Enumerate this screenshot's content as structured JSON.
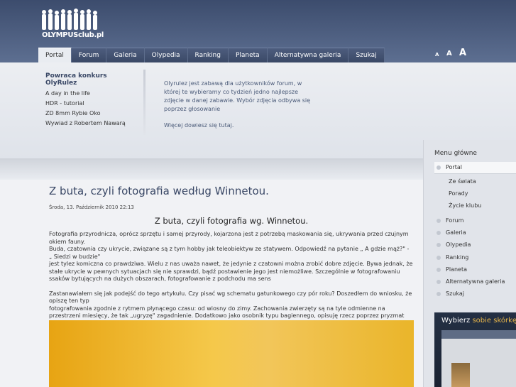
{
  "header": {
    "logo_text": "OLYMPUSclub.pl"
  },
  "nav": {
    "tabs": [
      "Portal",
      "Forum",
      "Galeria",
      "Olypedia",
      "Ranking",
      "Planeta",
      "Alternatywna galeria",
      "Szukaj"
    ],
    "active": "Portal"
  },
  "font_size_controls": [
    "A",
    "A",
    "A"
  ],
  "feature": {
    "title": "Powraca konkurs OlyRulez",
    "items": [
      "A day in the life",
      "HDR - tutorial",
      "ZD 8mm Rybie Oko",
      "Wywiad z Robertem Nawarą"
    ]
  },
  "description": {
    "text": "Olyrulez jest zabawą dla użytkowników forum, w której te wybieramy co tydzień jedno najlepsze zdjęcie w danej zabawie. Wybór zdjęcia odbywa się poprzez głosowanie",
    "more": "Więcej dowiesz się tutaj."
  },
  "article": {
    "title": "Z buta, czyli fotografia według Winnetou.",
    "date": "Środa, 13. Październik 2010 22:13",
    "subtitle": "Z buta, czyli fotografia wg. Winnetou.",
    "paragraphs": [
      "Fotografia przyrodnicza, oprócz sprzętu i samej przyrody, kojarzona jest z potrzebą maskowania się, ukrywania przed czujnym okiem fauny.",
      "Buda, czatownia czy ukrycie, związane są z tym hobby jak teleobiektyw ze statywem. Odpowiedź na pytanie „ A gdzie mąż?\" - „ Siedzi w budzie\"",
      "jest tylez komiczna co prawdziwa. Wielu z nas uważa nawet, że jedynie z czatowni można zrobić dobre zdjęcie. Bywa jednak, że stałe ukrycie w pewnych sytuacjach się nie sprawdzi, bądź postawienie jego jest niemożliwe. Szczególnie w fotografowaniu ssaków bytujących na dużych obszarach, fotografowanie z podchodu ma sens",
      "Zastanawiałem się jak podejść do tego artykułu. Czy pisać wg schematu gatunkowego czy pór roku? Doszedłem do wniosku, że opiszę ten typ",
      "fotografowania zgodnie z rytmem płynącego czasu: od wiosny do zimy. Zachowania zwierzęty są na tyle odmienne na przestrzeni miesięcy, że tak „ugryzę\" zagadnienie. Dodatkowo jako osobnik typu bagiennego, opisuję rzecz poprzez pryzmat gatunków biebrzańskich i wachlarzu ich zachowań."
    ]
  },
  "sidebar": {
    "title": "Menu główne",
    "items": [
      "Portal",
      "Forum",
      "Galeria",
      "Olypedia",
      "Ranking",
      "Planeta",
      "Alternatywna galeria",
      "Szukaj"
    ],
    "subitems": [
      "Ze świata",
      "Porady",
      "Życie klubu"
    ],
    "promo_prefix": "Wybierz",
    "promo_accent": "sobie skórkę"
  },
  "colors": {
    "header": "#4a5a7b",
    "accent": "#3a4866",
    "promo_accent": "#e8b64a"
  }
}
